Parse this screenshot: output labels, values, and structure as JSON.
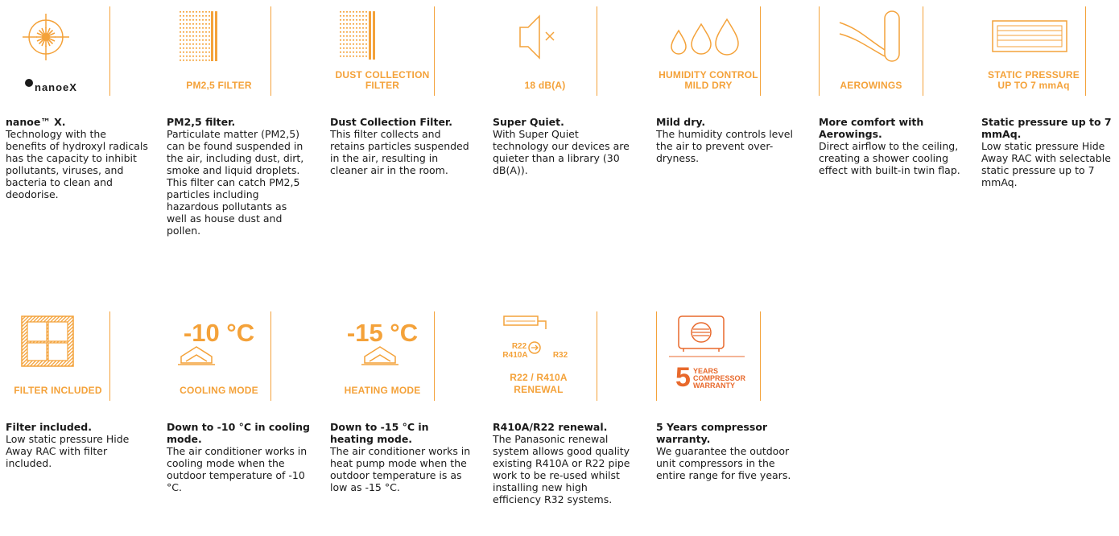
{
  "colors": {
    "accent": "#f4a23a",
    "warranty": "#e8692c",
    "text": "#1a1a1a"
  },
  "features": [
    {
      "icon": "nanoe-x-icon",
      "brand": "nanoeX",
      "title": "nanoe™ X.",
      "desc": "Technology with the benefits of hydroxyl radicals has the capacity to inhibit pollutants, viruses, and bacteria to clean and deodorise."
    },
    {
      "icon": "pm25-filter-icon",
      "label": "PM2,5 FILTER",
      "title": "PM2,5 filter.",
      "desc": "Particulate matter (PM2,5) can be found suspended in the air, including dust, dirt, smoke and liquid droplets. This filter can catch PM2,5 particles including hazardous pollutants as well as house dust and pollen."
    },
    {
      "icon": "dust-filter-icon",
      "label_line1": "DUST COLLECTION",
      "label_line2": "FILTER",
      "title": "Dust Collection Filter.",
      "desc": "This filter collects and retains particles suspended in the air, resulting in cleaner air in the room."
    },
    {
      "icon": "speaker-mute-icon",
      "label": "18 dB(A)",
      "title": "Super Quiet.",
      "desc": "With Super Quiet technology our devices are quieter than a library (30 dB(A))."
    },
    {
      "icon": "water-drops-icon",
      "label_line1": "HUMIDITY CONTROL",
      "label_line2": "MILD DRY",
      "title": "Mild dry.",
      "desc": "The humidity controls level the air to prevent over-dryness."
    },
    {
      "icon": "aerowings-icon",
      "label": "AEROWINGS",
      "title": "More comfort with Aerowings.",
      "desc": "Direct airflow to the ceiling, creating a shower cooling effect with built-in twin flap."
    },
    {
      "icon": "duct-unit-icon",
      "label_line1": "STATIC PRESSURE",
      "label_line2": "UP TO 7 mmAq",
      "title": "Static pressure up to 7 mmAq.",
      "desc": "Low static pressure Hide Away RAC with selectable static pressure up to 7 mmAq."
    },
    {
      "icon": "filter-grid-icon",
      "label": "FILTER INCLUDED",
      "title": "Filter included.",
      "desc": "Low static pressure Hide Away RAC with filter included."
    },
    {
      "icon": "house-cooling-icon",
      "big": "-10 °C",
      "label": "COOLING MODE",
      "title": "Down to -10 °C in cooling mode.",
      "desc": "The air conditioner works in cooling mode when the outdoor temperature of -10 °C."
    },
    {
      "icon": "house-heating-icon",
      "big": "-15 °C",
      "label": "HEATING MODE",
      "title": "Down to -15 °C in heating mode.",
      "desc": "The air conditioner works in heat pump mode when the outdoor temperature is as low as -15 °C."
    },
    {
      "icon": "refrigerant-renewal-icon",
      "small_r22": "R22",
      "small_r410a": "R410A",
      "small_r32": "R32",
      "label_line1": "R22 / R410A",
      "label_line2": "RENEWAL",
      "title": "R410A/R22 renewal.",
      "desc": "The Panasonic renewal system allows good quality existing R410A or R22 pipe work to be re-used whilst installing new high efficiency R32 systems."
    },
    {
      "icon": "outdoor-unit-icon",
      "warranty_number": "5",
      "warranty_line1": "YEARS",
      "warranty_line2": "COMPRESSOR",
      "warranty_line3": "WARRANTY",
      "title": "5 Years compressor warranty.",
      "desc": "We guarantee the outdoor unit compressors in the entire range for five years."
    }
  ]
}
